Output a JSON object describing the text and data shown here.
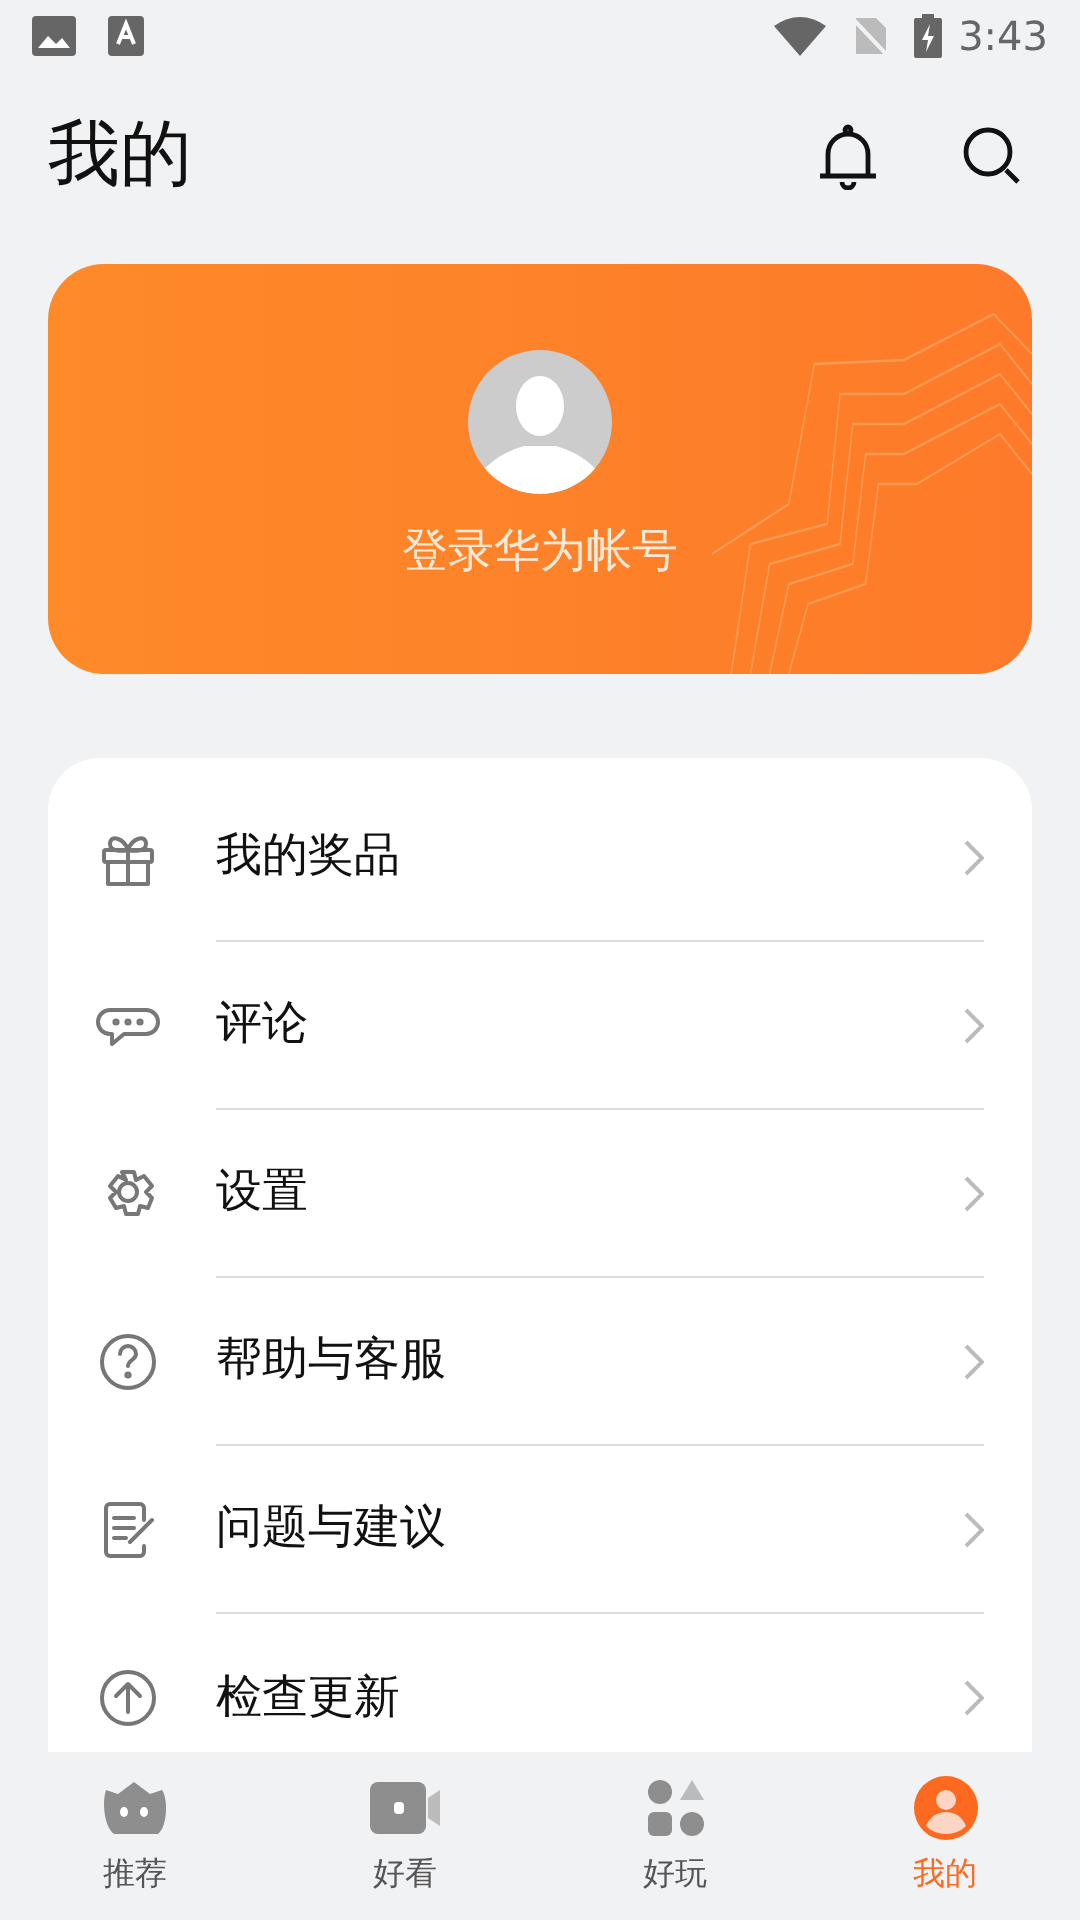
{
  "status_bar": {
    "time": "3:43"
  },
  "header": {
    "title": "我的"
  },
  "account_card": {
    "login_label": "登录华为帐号"
  },
  "menu": [
    {
      "kind": "gift",
      "label": "我的奖品"
    },
    {
      "kind": "comment",
      "label": "评论"
    },
    {
      "kind": "settings",
      "label": "设置"
    },
    {
      "kind": "help",
      "label": "帮助与客服"
    },
    {
      "kind": "feedback",
      "label": "问题与建议"
    },
    {
      "kind": "update",
      "label": "检查更新"
    }
  ],
  "bottom_nav": [
    {
      "kind": "recommend",
      "label": "推荐",
      "selected": false
    },
    {
      "kind": "watch",
      "label": "好看",
      "selected": false
    },
    {
      "kind": "play",
      "label": "好玩",
      "selected": false
    },
    {
      "kind": "me",
      "label": "我的",
      "selected": true
    }
  ]
}
